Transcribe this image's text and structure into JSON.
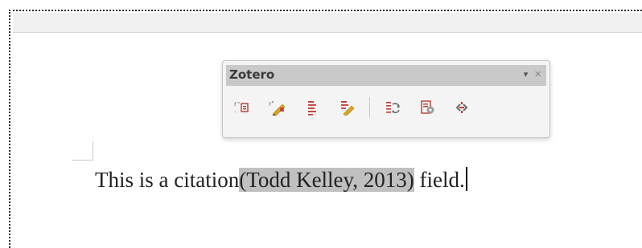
{
  "zotero_toolbar": {
    "title": "Zotero",
    "menu_glyph": "▾",
    "close_glyph": "×",
    "buttons": [
      {
        "icon": "add-edit-citation-icon"
      },
      {
        "icon": "add-edit-bibliography-icon"
      },
      {
        "icon": "insert-bibliography-icon"
      },
      {
        "icon": "edit-bibliography-icon"
      },
      {
        "icon": "refresh-icon"
      },
      {
        "icon": "document-preferences-icon"
      },
      {
        "icon": "unlink-citations-icon"
      }
    ]
  },
  "document": {
    "text_before": "This is a citation",
    "citation": "(Todd Kelley, 2013)",
    "text_after": " field."
  },
  "colors": {
    "citation_highlight": "#c0c0c0",
    "toolbar_titlebar": "#c9c9c9",
    "icon_red": "#c0392b",
    "icon_gold": "#d4a52a"
  }
}
